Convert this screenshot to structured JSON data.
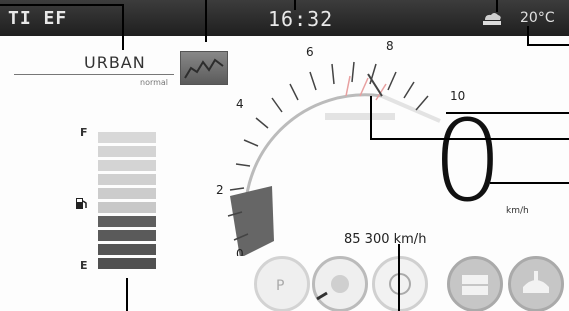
{
  "topbar": {
    "logo": "TI EF",
    "time": "16:32",
    "temperature": "20°C",
    "weather_icon": "cloud-icon"
  },
  "drive_mode": {
    "label": "URBAN",
    "sublabel": "normal",
    "icon": "mode-graph-icon"
  },
  "fuel_gauge": {
    "full_label": "F",
    "empty_label": "E",
    "pump_icon": "fuel-pump-icon"
  },
  "tachometer": {
    "ticks": [
      "0",
      "2",
      "4",
      "6",
      "8",
      "10"
    ]
  },
  "speed": {
    "value": "0",
    "unit": "km/h"
  },
  "cruise": {
    "text": "85 300 km/h"
  },
  "bottom_icons": [
    "parking-icon",
    "eco-icon",
    "brake-icon",
    "hold-icon",
    "tpms-icon"
  ]
}
